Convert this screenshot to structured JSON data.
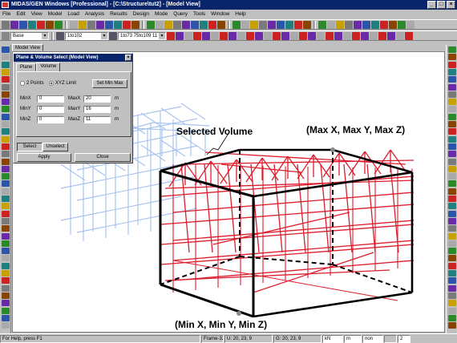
{
  "window": {
    "title": "MIDAS/GEN Windows [Professional] - [C:\\Structure\\tut2] - [Model View]",
    "controls": [
      "_",
      "□",
      "×"
    ]
  },
  "menu": [
    "File",
    "Edit",
    "View",
    "Model",
    "Load",
    "Analysis",
    "Results",
    "Design",
    "Mode",
    "Query",
    "Tools",
    "Window",
    "Help"
  ],
  "toolbar": {
    "base_combo": "Base",
    "select_combo": "1to102",
    "range_combo": "1to73 75to109 11"
  },
  "view_tab": "Model View",
  "dialog": {
    "title": "Plane & Volume Select (Model View)",
    "tabs": [
      "Plane",
      "Volume"
    ],
    "radio_two_points": "2 Points",
    "radio_xyz_limit": "XYZ Limit",
    "set_min_max": "Set Min Max",
    "fields": {
      "min_x_label": "MinX",
      "min_x_value": "0",
      "max_x_label": "MaxX",
      "max_x_value": "20",
      "min_y_label": "MinY",
      "min_y_value": "0",
      "max_y_label": "MaxY",
      "max_y_value": "16",
      "min_z_label": "MinZ",
      "min_z_value": "0",
      "max_z_label": "MaxZ",
      "max_z_value": "11",
      "unit": "m"
    },
    "select_button": "Select",
    "unselect_button": "Unselect",
    "apply_button": "Apply",
    "close_button": "Close"
  },
  "annotations": {
    "selected_volume": "Selected Volume",
    "max_corner": "(Max X, Max Y, Max Z)",
    "min_corner": "(Min X, Min Y, Min Z)"
  },
  "status": {
    "help": "For Help, press F1",
    "frame": "Frame-323",
    "u": "U: 20, 23, 9",
    "g": "G: 20, 23, 9",
    "unit1": "kN",
    "unit2": "m",
    "mode": "non",
    "page": "2"
  },
  "colors": {
    "title_bar": "#0a246a",
    "selected_member": "#dd1c2c",
    "unselected_member": "#a8c4ee",
    "selection_box": "#000000"
  }
}
